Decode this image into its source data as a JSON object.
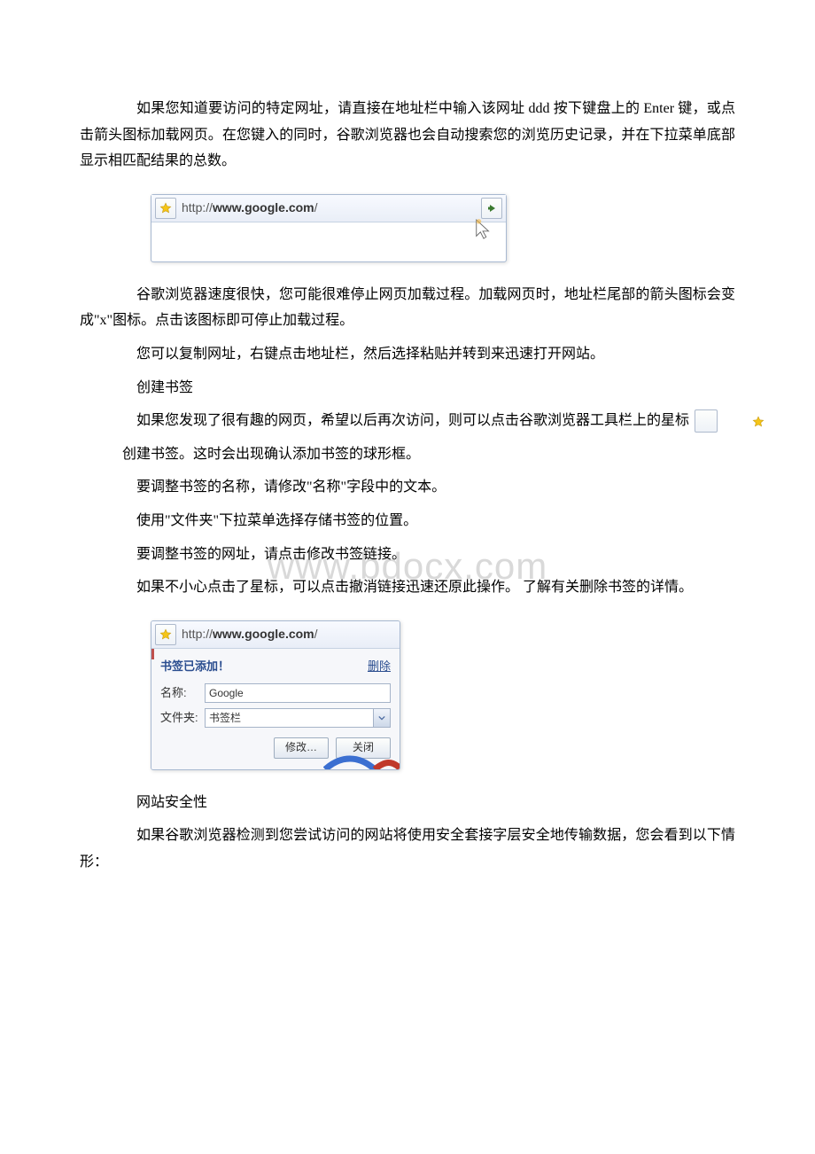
{
  "watermark": "www.bdocx.com",
  "paragraphs": {
    "p1": "如果您知道要访问的特定网址，请直接在地址栏中输入该网址 ddd 按下键盘上的 Enter 键，或点击箭头图标加载网页。在您键入的同时，谷歌浏览器也会自动搜索您的浏览历史记录，并在下拉菜单底部显示相匹配结果的总数。",
    "p2": "谷歌浏览器速度很快，您可能很难停止网页加载过程。加载网页时，地址栏尾部的箭头图标会变成\"x\"图标。点击该图标即可停止加载过程。",
    "p3": "您可以复制网址，右键点击地址栏，然后选择粘贴并转到来迅速打开网站。",
    "p4": "创建书签",
    "p5a": "如果您发现了很有趣的网页，希望以后再次访问，则可以点击谷歌浏览器工具栏上的星标",
    "p5b": "创建书签。这时会出现确认添加书签的球形框。",
    "p6": "要调整书签的名称，请修改\"名称\"字段中的文本。",
    "p7": "使用\"文件夹\"下拉菜单选择存储书签的位置。",
    "p8": "要调整书签的网址，请点击修改书签链接。",
    "p9": "如果不小心点击了星标，可以点击撤消链接迅速还原此操作。 了解有关删除书签的详情。",
    "p10": "网站安全性",
    "p11": "如果谷歌浏览器检测到您尝试访问的网站将使用安全套接字层安全地传输数据，您会看到以下情形："
  },
  "addressbar": {
    "prefix": "http://",
    "domain": "www.google.com",
    "suffix": "/"
  },
  "bookmark_popup": {
    "url_prefix": "http://",
    "url_domain": "www.google.com",
    "url_suffix": "/",
    "added_label": "书签已添加！",
    "delete_label": "删除",
    "name_label": "名称:",
    "name_value": "Google",
    "folder_label": "文件夹:",
    "folder_value": "书签栏",
    "edit_button": "修改…",
    "close_button": "关闭"
  }
}
